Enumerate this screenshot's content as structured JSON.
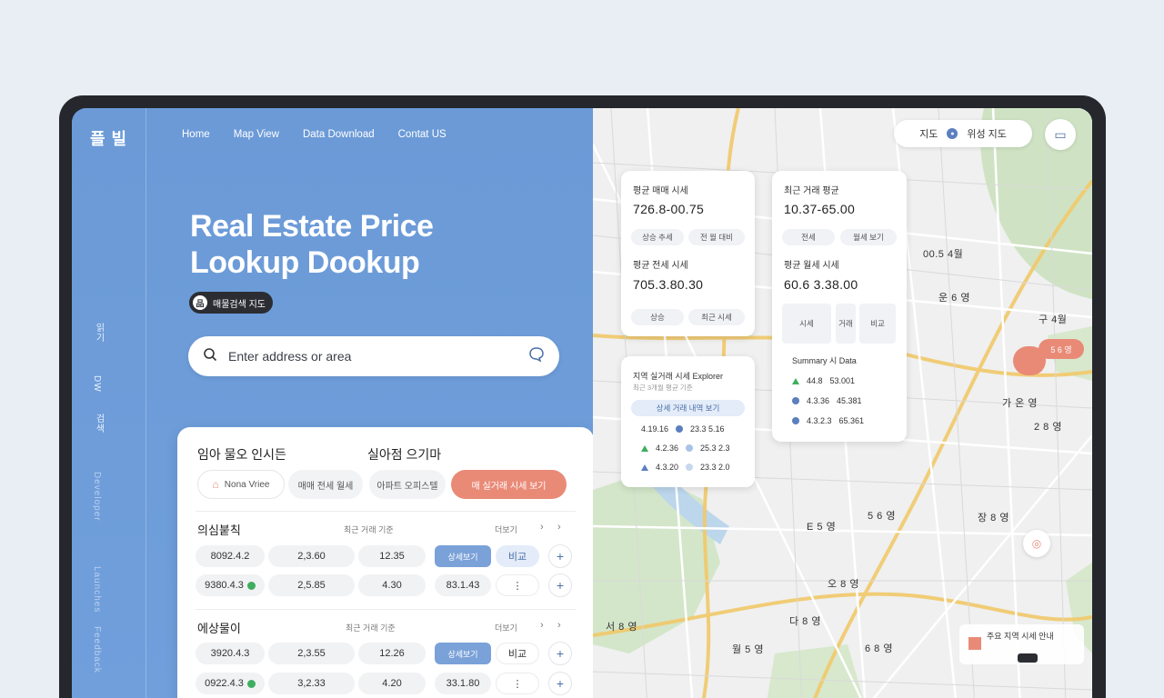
{
  "app": {
    "logo": "플 빌",
    "nav": [
      "Home",
      "Map View",
      "Data Download",
      "Contat US"
    ],
    "rail": [
      "읽기",
      "DW",
      "검색",
      "Developer",
      "Launches",
      "Feedback"
    ]
  },
  "hero": {
    "title_line1": "Real Estate Price",
    "title_line2": "Lookup Dookup",
    "tag_icon": "品",
    "tag_label": "매물검색 지도"
  },
  "search": {
    "placeholder": "Enter address or area"
  },
  "panel": {
    "heading_left": "임아 물오 인시든",
    "heading_right": "실아점 으기마",
    "chips": [
      "Nona Vriee",
      "매매 전세 월세",
      "아파트 오피스텔",
      "매 실거래 시세 보기"
    ],
    "section1": {
      "title": "의심붙칙",
      "meta": "최근 거래 기준",
      "meta2": "더보기",
      "rows": [
        {
          "a": "8092.4.2",
          "b": "2,3.60",
          "c": "12.35",
          "btn": "상세보기",
          "light": "비교"
        },
        {
          "a": "9380.4.3",
          "b": "2,5.85",
          "c": "4.30",
          "d": "83.1.43"
        }
      ]
    },
    "section2": {
      "title": "에상물이",
      "meta": "최근 거래 기준",
      "meta2": "더보기",
      "rows": [
        {
          "a": "3920.4.3",
          "b": "2,3.55",
          "c": "12.26",
          "btn": "상세보기",
          "light": "비교"
        },
        {
          "a": "0922.4.3",
          "b": "3,2.33",
          "c": "4.20",
          "d": "33.1.80"
        }
      ]
    }
  },
  "map": {
    "toggle_left": "지도",
    "toggle_right": "위성 지도",
    "cards": {
      "c1": {
        "title": "평균 매매 시세",
        "value": "726.8-00.75",
        "chips": [
          "상승 추세",
          "전 월 대비"
        ]
      },
      "c2": {
        "title": "최근 거래 평균",
        "value": "10.37-65.00",
        "chips": [
          "전세",
          "월세 보기"
        ]
      },
      "c3": {
        "title": "평균 전세 시세",
        "value": "705.3.80.30",
        "chips": [
          "상승",
          "최근 시세"
        ]
      },
      "c4": {
        "title": "평균 월세 시세",
        "value": "60.6 3.38.00",
        "bars": [
          "시세",
          "거래",
          "비교"
        ]
      },
      "c5": {
        "title": "지역 실거래 시세 Explorer",
        "sub": "최근 3개월 평균 기준",
        "chip": "상세 거래 내역 보기",
        "rows": [
          [
            "4.19.16",
            "23.3 5.16"
          ],
          [
            "4.2.36",
            "25.3 2.3"
          ],
          [
            "4.3.20",
            "23.3 2.0"
          ]
        ]
      },
      "c6": {
        "title": "Summary 시 Data",
        "rows": [
          [
            "44.8",
            "53.001"
          ],
          [
            "4.3.36",
            "45.381"
          ],
          [
            "4.3.2.3",
            "65.361"
          ]
        ]
      }
    },
    "labels": [
      "00.5 4월",
      "운 6 영",
      "구 4월",
      "가 온 영",
      "2 8 영",
      "5 6 영",
      "장 8 영",
      "E 5 영",
      "오 8 영",
      "다 8 영",
      "서 8 영",
      "월 5 영",
      "6 8 영"
    ],
    "pin_label": "5 6 영",
    "legend": "주요 지역 시세 안내"
  }
}
